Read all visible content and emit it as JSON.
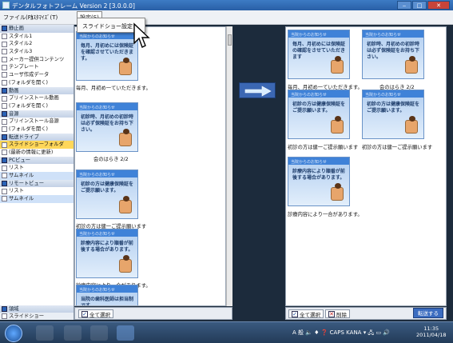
{
  "window": {
    "title": "デンタルフォトフレーム Version 2 [3.0.0.0]",
    "buttons": [
      "‒",
      "□",
      "✕"
    ]
  },
  "menu": {
    "file": "ファイル(F)",
    "settings_all": "ｶｽﾀﾏｲｽﾞ(T)",
    "settings": "設定(S)",
    "dropdown_item": "スライドショー設定"
  },
  "sidebar": {
    "rows": [
      {
        "label": "静止画",
        "kind": "head"
      },
      {
        "label": "スタイル1",
        "kind": "item"
      },
      {
        "label": "スタイル2",
        "kind": "item"
      },
      {
        "label": "スタイル3",
        "kind": "item"
      },
      {
        "label": "メーカー提供コンテンツ",
        "kind": "item"
      },
      {
        "label": "テンプレート",
        "kind": "item"
      },
      {
        "label": "ユーザ作成データ",
        "kind": "item"
      },
      {
        "label": "(フォルダを開く)",
        "kind": "item"
      },
      {
        "label": "動画",
        "kind": "head"
      },
      {
        "label": "プリインストール動画",
        "kind": "item"
      },
      {
        "label": "(フォルダを開く)",
        "kind": "item"
      },
      {
        "label": "音源",
        "kind": "head"
      },
      {
        "label": "プリインストール音源",
        "kind": "item"
      },
      {
        "label": "(フォルダを開く)",
        "kind": "item"
      },
      {
        "label": "転送ドライブ",
        "kind": "head"
      },
      {
        "label": "スライドショーフォルダ",
        "kind": "sel"
      },
      {
        "label": "(最新の情報に更新)",
        "kind": "item"
      },
      {
        "label": "PCビュー",
        "kind": "head"
      },
      {
        "label": "リスト",
        "kind": "item"
      },
      {
        "label": "サムネイル",
        "kind": "hl"
      },
      {
        "label": "リモートビュー",
        "kind": "head"
      },
      {
        "label": "リスト",
        "kind": "item"
      },
      {
        "label": "サムネイル",
        "kind": "hl"
      }
    ],
    "bottom": {
      "group": "領域",
      "item": "スライドショー"
    }
  },
  "left_list": {
    "items": [
      {
        "title": "毎月、月初めには保険証を確認させていただきます。",
        "caption": "毎月、月初め一ていただきます。"
      },
      {
        "title": "初診時、月初めの初診時は必ず保険証をお持ち下さい。",
        "caption": "会のはらき 2/2"
      },
      {
        "title": "初診の方は健康保険証をご提示願います。",
        "caption": "初診の方は健一ご提示願います"
      },
      {
        "title": "診療内容により順番が前後する場合があります。",
        "caption": "診療内容により一合があります。"
      },
      {
        "title": "当院の歯科医師は担当制です",
        "caption": ""
      }
    ],
    "select_all": "全て選択"
  },
  "right_list": {
    "items": [
      {
        "title": "毎月、月初めには保険証の確認をさせていただきます",
        "caption": "毎月、月初め一ていただきます。"
      },
      {
        "title": "初診時、月初めの初診時は必ず保険証をお持ち下さい。",
        "caption": "会のはらき 2/2"
      },
      {
        "title": "初診の方は健康保険証をご提示願います。",
        "caption": "初診の方は健一ご提示願います"
      },
      {
        "title": "初診の方は健康保険証をご提示願います。",
        "caption": "初診の方は健一ご提示願います"
      },
      {
        "title": "診療内容により順番が前後する場合があります。",
        "caption": "診療内容により一合があります。"
      }
    ],
    "select_all": "全て選択",
    "delete": "削除",
    "transfer": "転送する"
  },
  "thumb_header": "当院からのお知らせ",
  "taskbar": {
    "tray_text": "A 般 🔈 ♦ ❓ CAPS KANA ▾ 🖧 ▭ 🔊",
    "time": "11:35",
    "date": "2011/04/18"
  },
  "colors": {
    "accent": "#3b67b3",
    "selected": "#ffd75a",
    "background": "#1c2b3c"
  }
}
